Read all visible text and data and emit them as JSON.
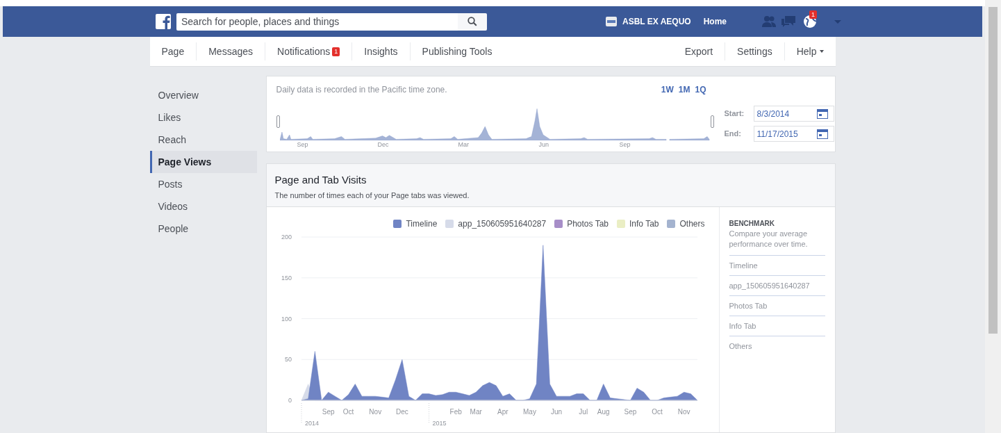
{
  "topbar": {
    "search": {
      "placeholder": "Search for people, places and things"
    },
    "page_name": "ASBL EX AEQUO",
    "home": "Home",
    "globe_badge": "1"
  },
  "page_nav": {
    "left": [
      {
        "label": "Page"
      },
      {
        "label": "Messages"
      },
      {
        "label": "Notifications",
        "badge": "1"
      },
      {
        "label": "Insights"
      },
      {
        "label": "Publishing Tools"
      }
    ],
    "right": [
      {
        "label": "Export",
        "kind": "link"
      },
      {
        "label": "Settings",
        "kind": "link"
      },
      {
        "label": "Help",
        "kind": "menu"
      }
    ]
  },
  "sidebar": {
    "items": [
      {
        "label": "Overview",
        "selected": false
      },
      {
        "label": "Likes",
        "selected": false
      },
      {
        "label": "Reach",
        "selected": false
      },
      {
        "label": "Page Views",
        "selected": true
      },
      {
        "label": "Posts",
        "selected": false
      },
      {
        "label": "Videos",
        "selected": false
      },
      {
        "label": "People",
        "selected": false
      }
    ]
  },
  "range": {
    "note": "Daily data is recorded in the Pacific time zone.",
    "presets": [
      "1W",
      "1M",
      "1Q"
    ],
    "months": [
      "Sep",
      "Dec",
      "Mar",
      "Jun",
      "Sep"
    ],
    "start_label": "Start:",
    "start": "8/3/2014",
    "end_label": "End:",
    "end": "11/17/2015"
  },
  "visits": {
    "title": "Page and Tab Visits",
    "subtitle": "The number of times each of your Page tabs was viewed.",
    "legend": [
      {
        "label": "Photos Tab",
        "color": "#a78ec8"
      },
      {
        "label": "Info Tab",
        "color": "#eaeec4"
      },
      {
        "label": "Others",
        "color": "#a4b3cf"
      }
    ],
    "chart_data": {
      "type": "area",
      "categories": [
        null,
        null,
        null,
        null,
        "Sep",
        null,
        null,
        "Oct",
        null,
        null,
        null,
        "Nov",
        null,
        null,
        null,
        "Dec",
        null,
        null,
        null,
        null,
        null,
        null,
        null,
        "Feb",
        null,
        null,
        "Mar",
        null,
        null,
        null,
        "Apr",
        null,
        null,
        null,
        "May",
        null,
        null,
        null,
        "Jun",
        null,
        null,
        null,
        "Jul",
        null,
        null,
        "Aug",
        null,
        null,
        null,
        "Sep",
        null,
        null,
        null,
        "Oct",
        null,
        null,
        null,
        "Nov",
        null,
        null
      ],
      "series": [
        {
          "name": "Timeline",
          "color": "#7084c4",
          "values": [
            0,
            2,
            60,
            0,
            10,
            5,
            0,
            7,
            20,
            5,
            5,
            5,
            4,
            3,
            25,
            50,
            5,
            0,
            8,
            8,
            6,
            7,
            10,
            10,
            8,
            6,
            10,
            18,
            22,
            18,
            5,
            8,
            0,
            0,
            2,
            20,
            190,
            20,
            5,
            5,
            5,
            8,
            8,
            0,
            0,
            20,
            3,
            2,
            1,
            0,
            15,
            10,
            0,
            0,
            3,
            4,
            5,
            10,
            8,
            0
          ]
        },
        {
          "name": "app_150605951640287",
          "color": "#d6dbe9",
          "values": [
            0,
            20,
            0,
            0,
            0,
            0,
            0,
            0,
            0,
            0,
            0,
            0,
            0,
            0,
            0,
            0,
            0,
            0,
            0,
            0,
            0,
            0,
            0,
            0,
            0,
            0,
            0,
            0,
            0,
            0,
            0,
            0,
            0,
            0,
            0,
            0,
            0,
            0,
            0,
            0,
            0,
            0,
            0,
            0,
            0,
            0,
            0,
            0,
            0,
            0,
            0,
            0,
            0,
            0,
            0,
            0,
            0,
            0,
            0,
            0
          ]
        }
      ],
      "grid": true,
      "ylim": [
        0,
        200
      ],
      "yticks": [
        0,
        50,
        100,
        150,
        200
      ],
      "annotations": [
        "2014",
        "2015"
      ]
    },
    "benchmark": {
      "title": "BENCHMARK",
      "text": "Compare your average performance over time.",
      "items": [
        "Timeline",
        "app_150605951640287",
        "Photos Tab",
        "Info Tab",
        "Others"
      ]
    }
  }
}
